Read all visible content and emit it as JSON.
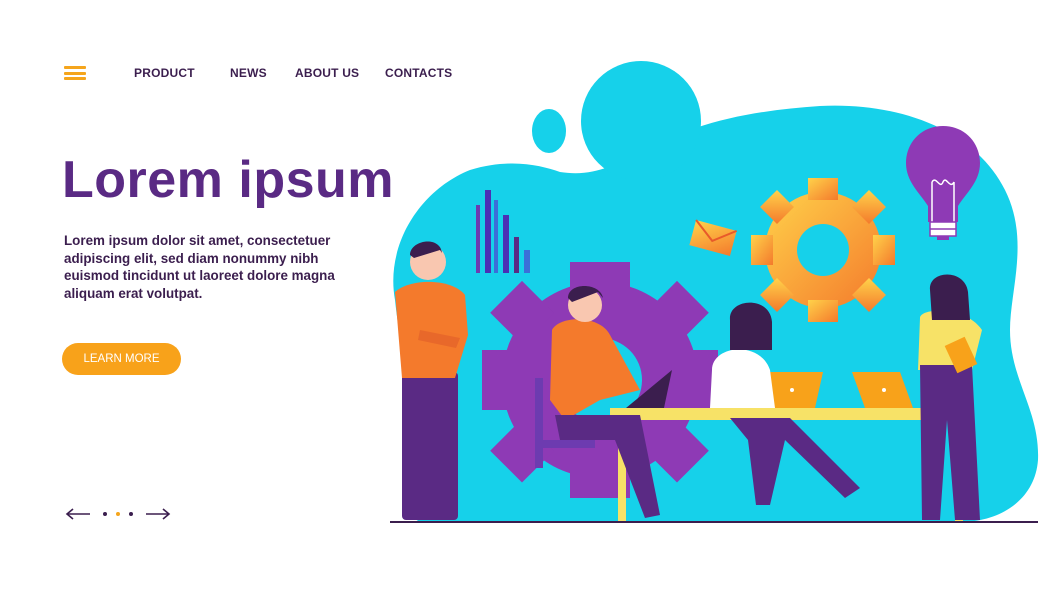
{
  "colors": {
    "accent": "#f8a21a",
    "brand_purple": "#5a2a84",
    "text_dark": "#3b1e4e",
    "blob_cyan": "#16d1ea"
  },
  "nav": {
    "menu_icon": "hamburger-menu-icon",
    "items": [
      {
        "label": "PRODUCT"
      },
      {
        "label": "NEWS"
      },
      {
        "label": "ABOUT US"
      },
      {
        "label": "CONTACTS"
      }
    ]
  },
  "hero": {
    "title": "Lorem ipsum",
    "body": "Lorem ipsum dolor sit amet, consectetuer adipiscing elit, sed diam nonummy nibh euismod tincidunt ut laoreet dolore magna aliquam erat volutpat.",
    "cta_label": "LEARN MORE"
  },
  "pager": {
    "prev_icon": "arrow-left-icon",
    "next_icon": "arrow-right-icon",
    "dot_count": 3,
    "active_dot": 2
  },
  "illustration": {
    "icons": [
      "bar-chart-icon",
      "envelope-icon",
      "lightbulb-icon",
      "gear-icon"
    ]
  }
}
